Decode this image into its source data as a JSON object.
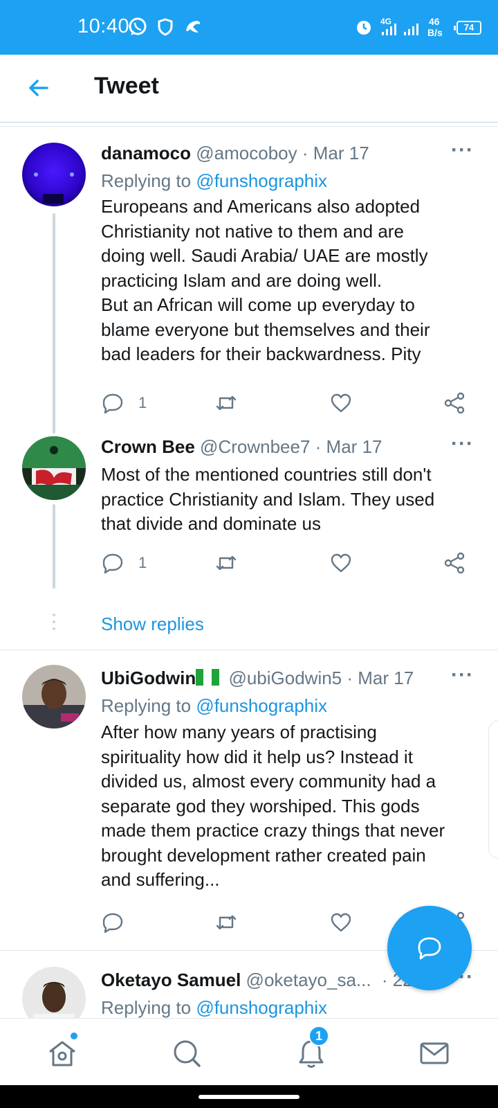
{
  "status_bar": {
    "time": "10:40",
    "network_top": "4G",
    "speed_value": "46",
    "speed_unit": "B/s",
    "battery": "74",
    "icons": [
      "whatsapp-icon",
      "shield-icon",
      "dolphin-icon",
      "alarm-icon",
      "signal-icon",
      "signal-icon-2"
    ]
  },
  "header": {
    "title": "Tweet",
    "back_icon": "arrow-left-icon"
  },
  "tweets": [
    {
      "name": "danamoco",
      "handle": "@amocoboy",
      "date": "· Mar 17",
      "replying_prefix": "Replying to ",
      "replying_to": "@funshographix",
      "text": "Europeans and Americans also adopted\nChristianity not native to them and are\ndoing well. Saudi Arabia/ UAE are mostly\npracticing Islam and are doing well.\nBut an African will come up everyday to\nblame everyone but themselves and their\nbad leaders for their backwardness. Pity",
      "reply_count": "1",
      "retweet_count": "",
      "like_count": ""
    },
    {
      "name": "Crown Bee",
      "handle": "@Crownbee7",
      "date": "· Mar 17",
      "text": "Most of the mentioned countries still don't\npractice Christianity and Islam. They used\nthat divide and dominate us",
      "reply_count": "1",
      "retweet_count": "",
      "like_count": ""
    },
    {
      "name": "UbiGodwin",
      "name_flag": "nigeria-flag-icon",
      "handle": "@ubiGodwin5",
      "date": "· Mar 17",
      "replying_prefix": "Replying to ",
      "replying_to": "@funshographix",
      "text": "After how many years of practising\nspirituality how did it help us? Instead it\ndivided us, almost every community had a\nseparate god they worshiped. This gods\nmade them practice crazy things that never\nbrought development rather created pain\nand suffering...",
      "reply_count": "",
      "retweet_count": "",
      "like_count": ""
    },
    {
      "name": "Oketayo Samuel",
      "handle": "@oketayo_sa...",
      "date": "· 22",
      "replying_prefix": "Replying to ",
      "replying_to": "@funshographix"
    }
  ],
  "show_replies": "Show replies",
  "more_label": "···",
  "bottom_nav": {
    "items": [
      "home-icon",
      "search-icon",
      "notifications-icon",
      "messages-icon"
    ],
    "notification_badge": "1"
  },
  "colors": {
    "brand": "#1da1f2",
    "mention": "#1b95e0",
    "secondary_text": "#657786",
    "primary_text": "#14171a"
  }
}
